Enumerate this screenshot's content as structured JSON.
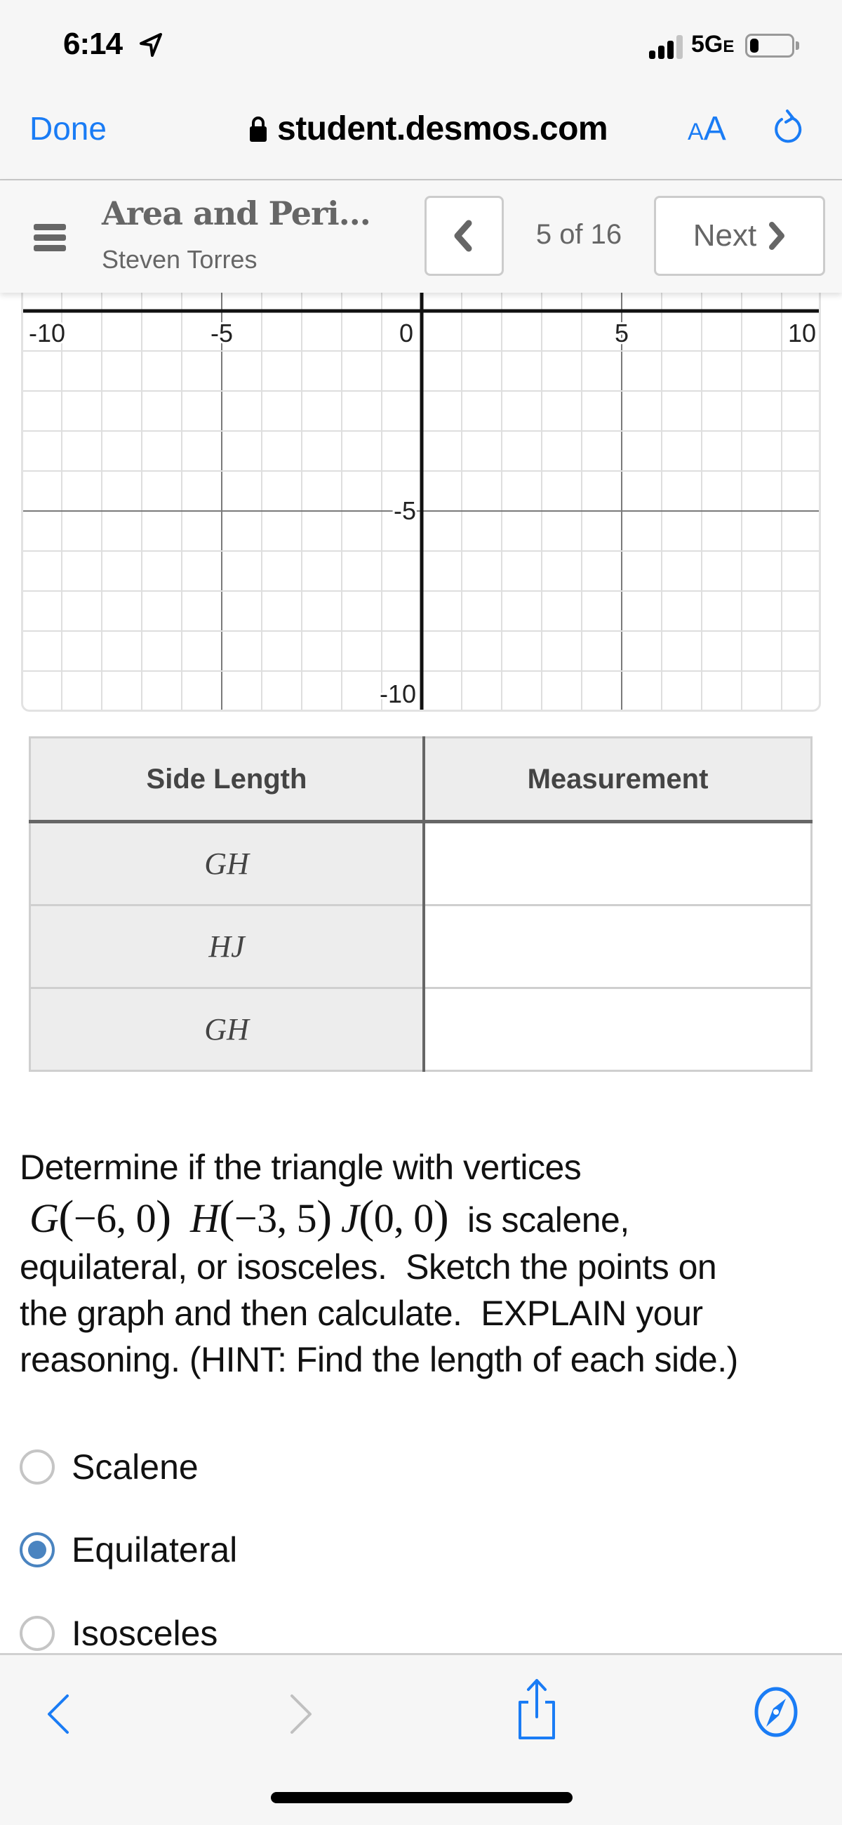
{
  "status_bar": {
    "time": "6:14",
    "network": "5G",
    "network_suffix": "E",
    "signal_bars_filled": 3,
    "signal_bars_total": 4,
    "battery_level": 0.2
  },
  "browser": {
    "done_label": "Done",
    "url": "student.desmos.com",
    "aa_small": "A",
    "aa_large": "A",
    "icons": [
      "lock-icon",
      "reload-icon"
    ]
  },
  "desmos_header": {
    "activity_title": "Area and Peri...",
    "student_name": "Steven Torres",
    "page_indicator": "5 of 16",
    "next_label": "Next",
    "icons": [
      "hamburger-icon",
      "chevron-left-icon",
      "chevron-right-icon"
    ]
  },
  "graph": {
    "x_range": [
      -10,
      10
    ],
    "y_range_visible": [
      -10,
      0.45
    ],
    "x_tick_labels": [
      "-10",
      "-5",
      "0",
      "5",
      "10"
    ],
    "y_tick_labels": [
      "-5",
      "-10"
    ],
    "grid_step": 1,
    "major_step": 5
  },
  "table": {
    "headers": [
      "Side Length",
      "Measurement"
    ],
    "rows": [
      {
        "side": "GH",
        "measurement": ""
      },
      {
        "side": "HJ",
        "measurement": ""
      },
      {
        "side": "GH",
        "measurement": ""
      }
    ]
  },
  "question": {
    "intro": "Determine if the triangle with vertices",
    "vertices": [
      {
        "name": "G",
        "coords": "−6, 0"
      },
      {
        "name": "H",
        "coords": "−3, 5"
      },
      {
        "name": "J",
        "coords": "0, 0"
      }
    ],
    "after_vertices": " is scalene,",
    "rest_lines": [
      "equilateral, or isosceles.  Sketch the points on",
      "the graph and then calculate.  EXPLAIN your",
      "reasoning. (HINT: Find the length of each side.)"
    ]
  },
  "choices": [
    {
      "label": "Scalene",
      "selected": false
    },
    {
      "label": "Equilateral",
      "selected": true
    },
    {
      "label": "Isosceles",
      "selected": false
    }
  ],
  "toolbar": {
    "icons": [
      "back-icon",
      "forward-icon",
      "share-icon",
      "compass-icon"
    ],
    "accent_color": "#1a7cf5",
    "disabled_color": "#c0c0c0"
  }
}
